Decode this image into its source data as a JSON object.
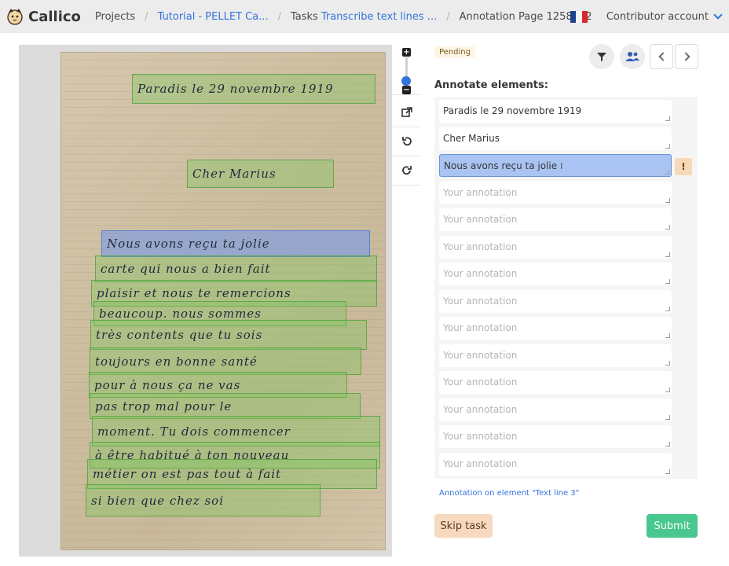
{
  "app": {
    "name": "Callico"
  },
  "breadcrumb": {
    "projects": "Projects",
    "project": "Tutorial - PELLET Ca...",
    "tasks_label": "Tasks",
    "task": "Transcribe text lines ...",
    "page": "Annotation Page 1258612"
  },
  "account": {
    "label": "Contributor account"
  },
  "colors": {
    "accent": "#3273dc",
    "success": "#48c78e",
    "selected_box": "#6e96f0",
    "line_box": "#78c85a"
  },
  "document_lines": [
    "Paradis le 29 novembre 1919",
    "Cher Marius",
    "Nous avons reçu ta jolie",
    "carte qui nous a bien fait",
    "plaisir et nous te remercions",
    "beaucoup. nous sommes",
    "très contents que tu sois",
    "toujours en bonne santé",
    "pour à nous ça ne vas",
    "pas trop mal pour le",
    "moment. Tu dois commencer",
    "à être habitué à ton nouveau",
    "métier on est pas tout à fait",
    "si bien que chez soi"
  ],
  "status": "Pending",
  "heading": "Annotate elements:",
  "annotations": [
    "Paradis le 29 novembre 1919",
    "Cher Marius",
    "Nous avons reçu ta jolie"
  ],
  "placeholder": "Your annotation",
  "warning_mark": "!",
  "element_note": "Annotation on element \"Text line 3\"",
  "buttons": {
    "skip": "Skip task",
    "submit": "Submit"
  }
}
